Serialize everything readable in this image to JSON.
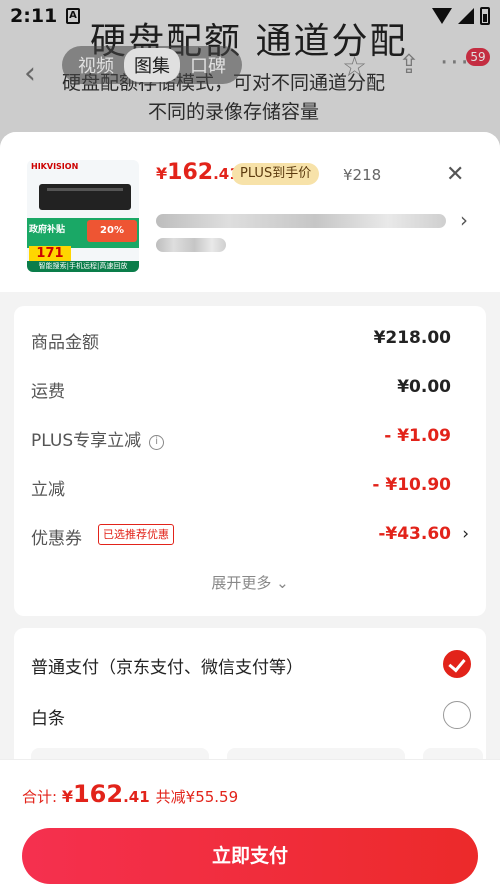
{
  "status_bar": {
    "time": "2:11",
    "notif_icon": "A"
  },
  "background_page": {
    "banner_title": "硬盘配额 通道分配",
    "banner_line1": "硬盘配额存储模式，可对不同通道分配",
    "banner_line2": "不同的录像存储容量",
    "media_tabs": [
      "视频",
      "图集",
      "口碑"
    ],
    "active_media_tab": "图集",
    "cart_badge": "59"
  },
  "product": {
    "thumb_brand": "HIKVISION",
    "thumb_badge_gov": "政府补贴",
    "thumb_badge_20": "20%",
    "thumb_price": "171",
    "thumb_tags": "智能搜索|手机远程|高速回放",
    "price_currency": "¥",
    "price_int": "162",
    "price_dec": ".41",
    "plus_tag": "PLUS到手价",
    "original_price": "¥218",
    "close_icon": "✕",
    "title_chevron": "›"
  },
  "price_detail": {
    "rows": [
      {
        "label": "商品金额",
        "value": "¥218.00",
        "red": false
      },
      {
        "label": "运费",
        "value": "¥0.00",
        "red": false
      },
      {
        "label": "PLUS专享立减",
        "value": "- ¥1.09",
        "red": true
      },
      {
        "label": "立减",
        "value": "- ¥10.90",
        "red": true
      },
      {
        "label": "优惠券",
        "value": "-¥43.60",
        "red": true
      }
    ],
    "coupon_tag": "已选推荐优惠",
    "expand_label": "展开更多 ⌄"
  },
  "payment": {
    "methods": [
      {
        "label": "普通支付（京东支付、微信支付等）",
        "selected": true
      },
      {
        "label": "白条",
        "selected": false
      }
    ]
  },
  "bottom_bar": {
    "total_label": "合计: ",
    "total_currency": "¥",
    "total_int": "162",
    "total_dec": ".41",
    "total_saved": "共减¥55.59",
    "pay_button_label": "立即支付"
  },
  "colors": {
    "accent_red": "#e2231a",
    "plus_gold": "#f7e2a9"
  }
}
